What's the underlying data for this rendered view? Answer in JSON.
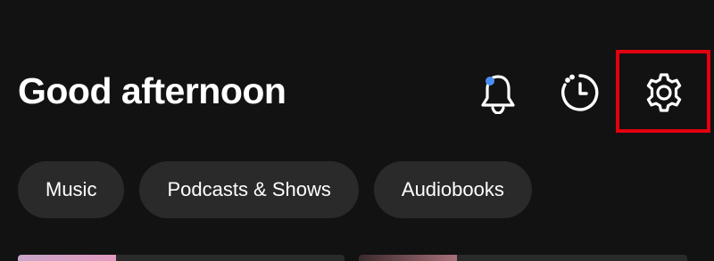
{
  "header": {
    "greeting": "Good afternoon",
    "icons": {
      "notifications": "bell-icon",
      "history": "history-icon",
      "settings": "gear-icon"
    },
    "notification_dot_color": "#4a8df5",
    "highlight_color": "#e3000f"
  },
  "filters": {
    "chips": [
      {
        "label": "Music"
      },
      {
        "label": "Podcasts & Shows"
      },
      {
        "label": "Audiobooks"
      }
    ]
  },
  "colors": {
    "background": "#121212",
    "chip_background": "#2a2a2a",
    "text": "#ffffff"
  }
}
